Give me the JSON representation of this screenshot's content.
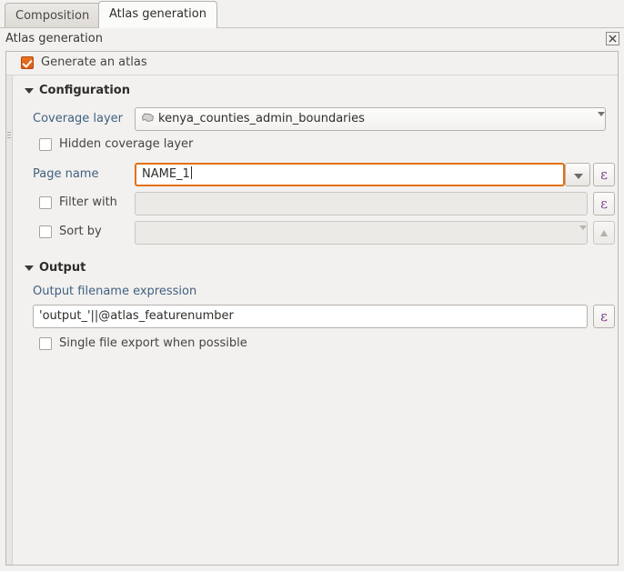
{
  "tabs": [
    {
      "label": "Composition",
      "active": false
    },
    {
      "label": "Atlas generation",
      "active": true
    }
  ],
  "panel": {
    "title": "Atlas generation",
    "close_icon": "close-icon"
  },
  "generate_atlas": {
    "label": "Generate an atlas",
    "checked": true
  },
  "configuration": {
    "heading": "Configuration",
    "coverage_layer": {
      "label": "Coverage layer",
      "value": "kenya_counties_admin_boundaries",
      "icon": "polygon-layer-icon"
    },
    "hidden_coverage_layer": {
      "label": "Hidden coverage layer",
      "checked": false
    },
    "page_name": {
      "label": "Page name",
      "value": "NAME_1",
      "expression_button": "ε"
    },
    "filter_with": {
      "label": "Filter with",
      "checked": false,
      "value": "",
      "placeholder": "",
      "expression_button": "ε"
    },
    "sort_by": {
      "label": "Sort by",
      "checked": false,
      "value": "",
      "placeholder": ""
    }
  },
  "output": {
    "heading": "Output",
    "filename_expression": {
      "label": "Output filename expression",
      "value": "'output_'||@atlas_featurenumber",
      "expression_button": "ε"
    },
    "single_file_export": {
      "label": "Single file export when possible",
      "checked": false
    }
  },
  "colors": {
    "accent_orange": "#e2700f",
    "checkbox_checked": "#dd5c17",
    "expression_purple": "#7a3b8f",
    "panel_background": "#f2f1f0"
  }
}
